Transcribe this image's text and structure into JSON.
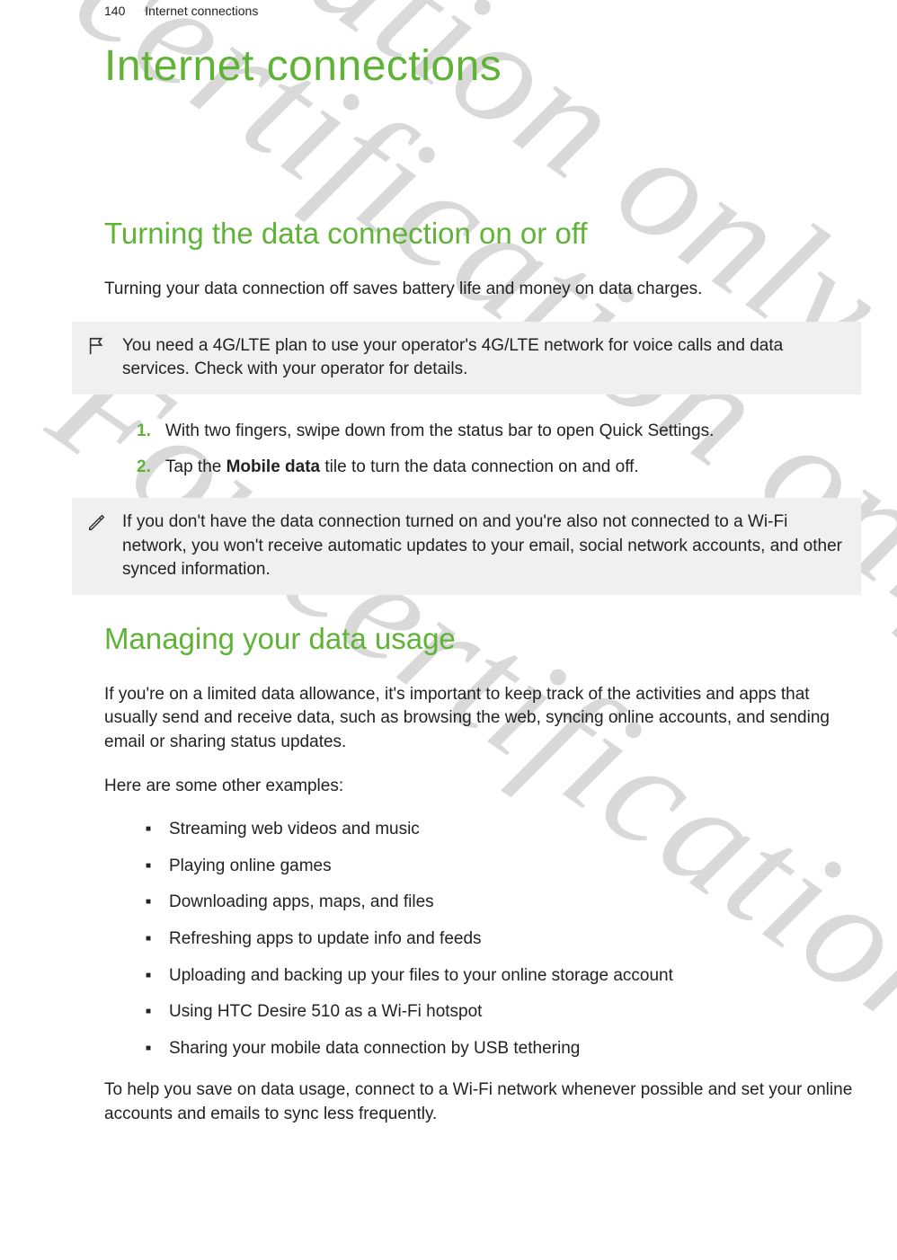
{
  "header": {
    "page_num": "140",
    "section": "Internet connections"
  },
  "chapter_title": "Internet connections",
  "section1": {
    "title": "Turning the data connection on or off",
    "intro": "Turning your data connection off saves battery life and money on data charges.",
    "callout1": "You need a 4G/LTE plan to use your operator's 4G/LTE network for voice calls and data services. Check with your operator for details.",
    "steps": [
      {
        "num": "1.",
        "text": "With two fingers, swipe down from the status bar to open Quick Settings."
      },
      {
        "num": "2.",
        "prefix": "Tap the ",
        "bold": "Mobile data",
        "suffix": " tile to turn the data connection on and off."
      }
    ],
    "callout2": "If you don't have the data connection turned on and you're also not connected to a Wi-Fi network, you won't receive automatic updates to your email, social network accounts, and other synced information."
  },
  "section2": {
    "title": "Managing your data usage",
    "p1": "If you're on a limited data allowance, it's important to keep track of the activities and apps that usually send and receive data, such as browsing the web, syncing online accounts, and sending email or sharing status updates.",
    "p2": "Here are some other examples:",
    "bullets": [
      "Streaming web videos and music",
      "Playing online games",
      "Downloading apps, maps, and files",
      "Refreshing apps to update info and feeds",
      "Uploading and backing up your files to your online storage account",
      "Using HTC Desire 510 as a Wi-Fi hotspot",
      "Sharing your mobile data connection by USB tethering"
    ],
    "p3": "To help you save on data usage, connect to a Wi-Fi network whenever possible and set your online accounts and emails to sync less frequently."
  },
  "watermarks": {
    "text": "For certification only"
  }
}
